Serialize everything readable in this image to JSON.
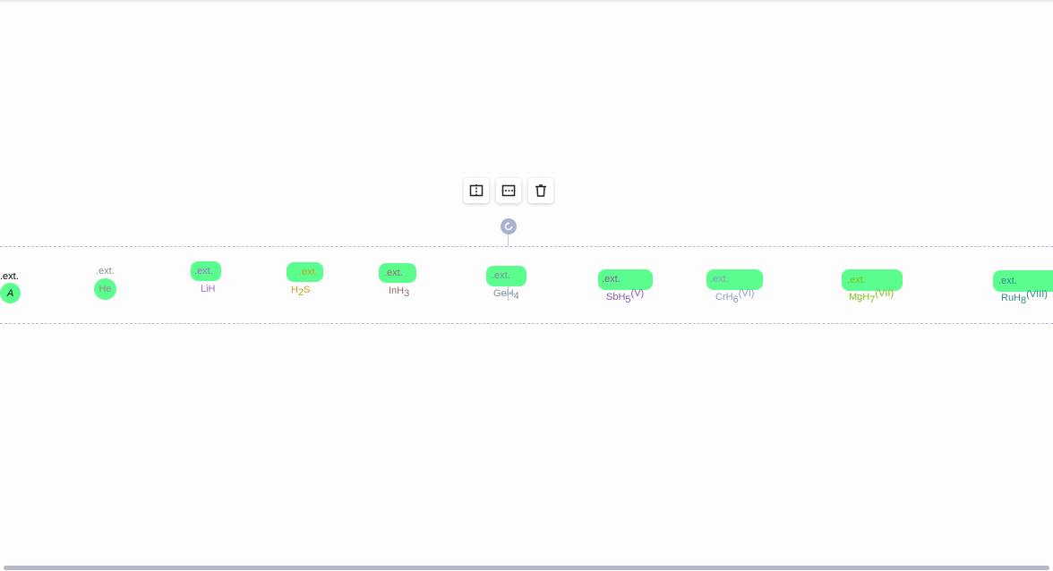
{
  "toolbar": {
    "split_vertical_label": "",
    "split_horizontal_label": "",
    "delete_label": ""
  },
  "badge_text": ".ext.",
  "molecules": [
    {
      "ext": ".ext.",
      "main": "A",
      "sub": "",
      "tail": "",
      "sup": "",
      "color": "#000000"
    },
    {
      "ext": ".ext.",
      "main": "He",
      "sub": "",
      "tail": "",
      "sup": "",
      "color": "#8f8f8f"
    },
    {
      "ext": ".ext.",
      "main": "LiH",
      "sub": "",
      "tail": "",
      "sup": "",
      "color": "#a569d6"
    },
    {
      "ext": ".ext.",
      "main": "H",
      "sub": "2",
      "tail": "S",
      "sup": "",
      "color": "#c9a21a"
    },
    {
      "ext": ".ext.",
      "main": "InH",
      "sub": "3",
      "tail": "",
      "sup": "",
      "color": "#9b6b6b"
    },
    {
      "ext": ".ext.",
      "main": "GeH",
      "sub": "4",
      "tail": "",
      "sup": "",
      "color": "#7b8fa0"
    },
    {
      "ext": ".ext.",
      "main": "SbH",
      "sub": "5",
      "tail": "",
      "sup": "(V)",
      "color": "#8e5aa8"
    },
    {
      "ext": ".ext.",
      "main": "CrH",
      "sub": "6",
      "tail": "",
      "sup": "(VI)",
      "color": "#8f9ac4"
    },
    {
      "ext": ".ext.",
      "main": "MgH",
      "sub": "7",
      "tail": "",
      "sup": "(VII)",
      "color": "#7ac21b"
    },
    {
      "ext": ".ext.",
      "main": "RuH",
      "sub": "8",
      "tail": "",
      "sup": "(VIII)",
      "color": "#2f8c8c"
    }
  ]
}
